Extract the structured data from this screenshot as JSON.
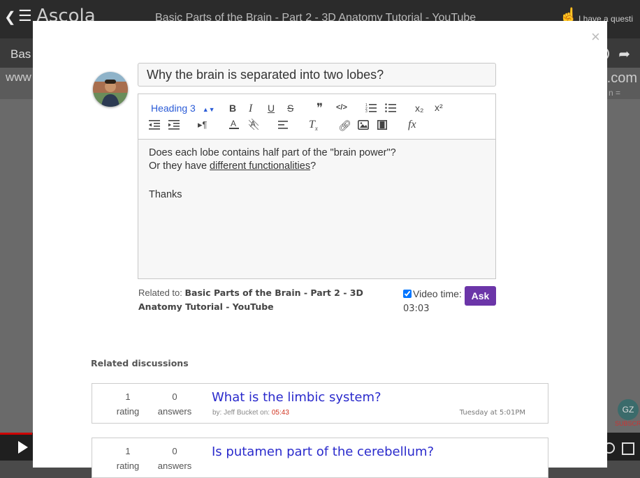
{
  "background": {
    "logo": "Ascola",
    "video_title": "Basic Parts of the Brain - Part 2 - 3D Anatomy Tutorial - YouTube",
    "ask_prompt": "I have a questi",
    "bar_text": "Bas",
    "url_left": "www",
    "url_right": "s.com",
    "url_sub": "n =",
    "subscribe": "SUBSCRIBE",
    "channel_initials": "GZ"
  },
  "modal": {
    "close": "×",
    "question_title": "Why the brain is separated into two lobes?",
    "toolbar": {
      "heading_select": "Heading 3",
      "bold": "B",
      "italic": "I",
      "underline": "U",
      "strike": "S",
      "quote": "❞",
      "code": "</>",
      "subscript": "x₂",
      "superscript": "x²",
      "formula": "fx"
    },
    "body": {
      "line1": "Does each lobe contains half part of the \"brain power\"?",
      "line2_prefix": "Or they have ",
      "line2_link": "different functionalities",
      "line2_suffix": "?",
      "line3": "Thanks"
    },
    "related_to_label": "Related to: ",
    "related_to_value": "Basic Parts of the Brain - Part 2 - 3D Anatomy Tutorial - YouTube",
    "video_time_label": "Video time:",
    "video_time_value": "03:03",
    "video_time_checked": true,
    "ask_button": "Ask",
    "related_heading": "Related discussions",
    "discussions": [
      {
        "rating": "1",
        "rating_label": "rating",
        "answers": "0",
        "answers_label": "answers",
        "question": "What is the limbic system?",
        "by_label": "by: Jeff Bucket on: ",
        "time": "05:43",
        "date": "Tuesday at 5:01PM"
      },
      {
        "rating": "1",
        "rating_label": "rating",
        "answers": "0",
        "answers_label": "answers",
        "question": "Is putamen part of the cerebellum?",
        "by_label": "",
        "time": "",
        "date": ""
      }
    ]
  }
}
